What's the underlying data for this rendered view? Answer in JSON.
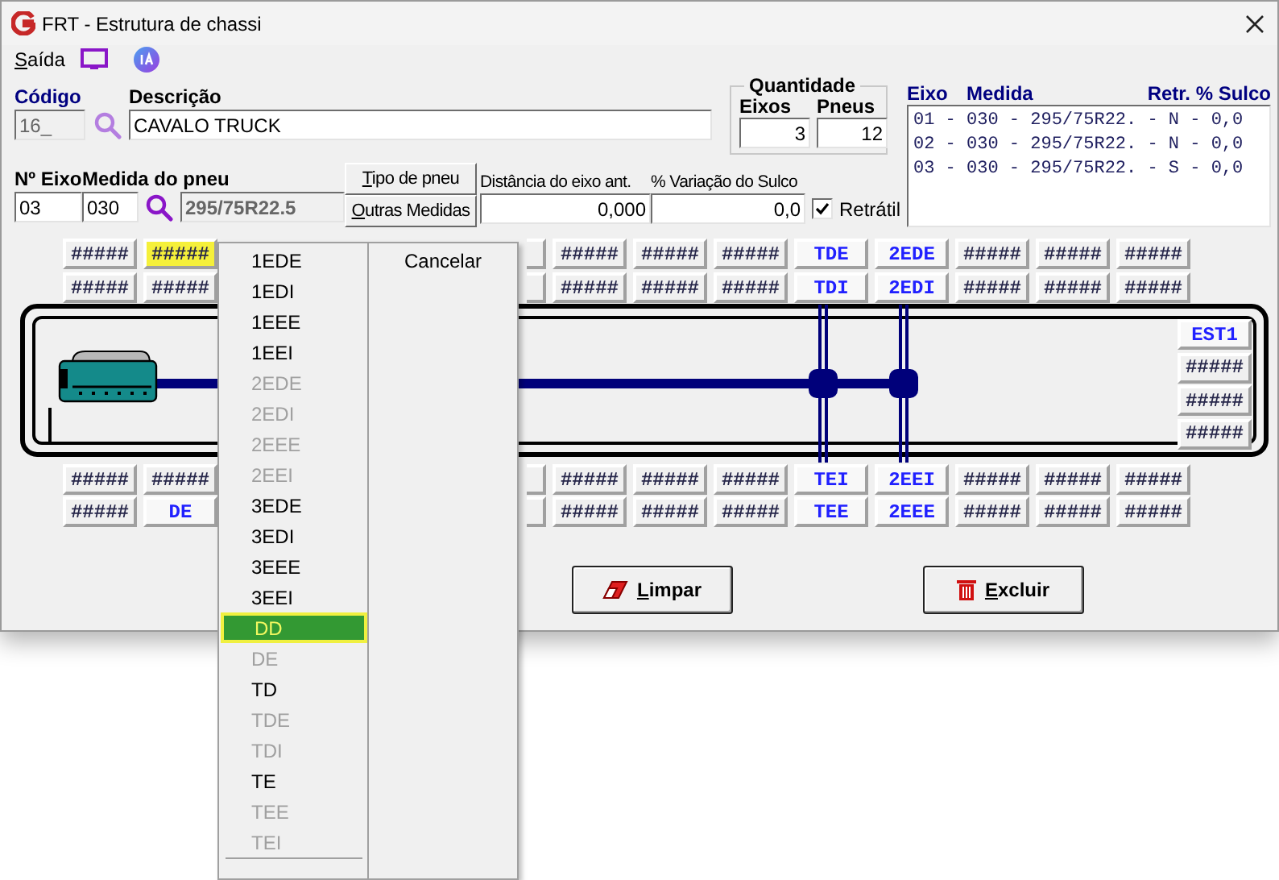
{
  "window": {
    "title": "FRT - Estrutura de chassi"
  },
  "menu_bar": [
    {
      "label": "Saída"
    }
  ],
  "form": {
    "codigo": {
      "label": "Código",
      "value": "16_"
    },
    "descricao": {
      "label": "Descrição",
      "value": "CAVALO TRUCK"
    },
    "quantidade": {
      "title": "Quantidade",
      "eixos": {
        "label": "Eixos",
        "value": "3"
      },
      "pneus": {
        "label": "Pneus",
        "value": "12"
      }
    },
    "axle_list": {
      "columns": [
        "Eixo",
        "Medida",
        "Retr.",
        "% Sulco"
      ],
      "rows": [
        "01 - 030 - 295/75R22. - N - 0,0",
        "02 - 030 - 295/75R22. - N - 0,0",
        "03 - 030 - 295/75R22. - S - 0,0"
      ]
    },
    "n_eixo": {
      "label": "Nº Eixo",
      "value": "03"
    },
    "medida": {
      "label": "Medida do pneu",
      "value": "030",
      "description": "295/75R22.5"
    },
    "buttons": [
      "Tipo de pneu",
      "Outras Medidas"
    ],
    "distancia": {
      "label": "Distância do eixo ant.",
      "value": "0,000"
    },
    "variacao": {
      "label": "% Variação do Sulco",
      "value": "0,0"
    },
    "retratil": {
      "label": "Retrátil",
      "checked": true
    }
  },
  "tire_grid": {
    "rows": [
      {
        "left": [
          {
            "label": "#####",
            "kind": "empty",
            "highlighted": false
          },
          {
            "label": "#####",
            "kind": "empty",
            "highlighted": true
          }
        ],
        "right": [
          {
            "label": "#####",
            "kind": "empty",
            "highlighted": false
          },
          {
            "label": "#####",
            "kind": "empty",
            "highlighted": false
          },
          {
            "label": "#####",
            "kind": "empty",
            "highlighted": false
          },
          {
            "label": "TDE",
            "kind": "assigned",
            "highlighted": false
          },
          {
            "label": "2EDE",
            "kind": "assigned",
            "highlighted": false
          },
          {
            "label": "#####",
            "kind": "empty",
            "highlighted": false
          },
          {
            "label": "#####",
            "kind": "empty",
            "highlighted": false
          },
          {
            "label": "#####",
            "kind": "empty",
            "highlighted": false
          }
        ]
      },
      {
        "left": [
          {
            "label": "#####",
            "kind": "empty",
            "highlighted": false
          },
          {
            "label": "#####",
            "kind": "empty",
            "highlighted": false
          }
        ],
        "right": [
          {
            "label": "#####",
            "kind": "empty",
            "highlighted": false
          },
          {
            "label": "#####",
            "kind": "empty",
            "highlighted": false
          },
          {
            "label": "#####",
            "kind": "empty",
            "highlighted": false
          },
          {
            "label": "TDI",
            "kind": "assigned",
            "highlighted": false
          },
          {
            "label": "2EDI",
            "kind": "assigned",
            "highlighted": false
          },
          {
            "label": "#####",
            "kind": "empty",
            "highlighted": false
          },
          {
            "label": "#####",
            "kind": "empty",
            "highlighted": false
          },
          {
            "label": "#####",
            "kind": "empty",
            "highlighted": false
          }
        ]
      },
      {
        "left": [
          {
            "label": "#####",
            "kind": "empty",
            "highlighted": false
          },
          {
            "label": "#####",
            "kind": "empty",
            "highlighted": false
          }
        ],
        "right": [
          {
            "label": "#####",
            "kind": "empty",
            "highlighted": false
          },
          {
            "label": "#####",
            "kind": "empty",
            "highlighted": false
          },
          {
            "label": "#####",
            "kind": "empty",
            "highlighted": false
          },
          {
            "label": "TEI",
            "kind": "assigned",
            "highlighted": false
          },
          {
            "label": "2EEI",
            "kind": "assigned",
            "highlighted": false
          },
          {
            "label": "#####",
            "kind": "empty",
            "highlighted": false
          },
          {
            "label": "#####",
            "kind": "empty",
            "highlighted": false
          },
          {
            "label": "#####",
            "kind": "empty",
            "highlighted": false
          }
        ]
      },
      {
        "left": [
          {
            "label": "#####",
            "kind": "empty",
            "highlighted": false
          },
          {
            "label": "DE",
            "kind": "assigned",
            "highlighted": false
          }
        ],
        "right": [
          {
            "label": "#####",
            "kind": "empty",
            "highlighted": false
          },
          {
            "label": "#####",
            "kind": "empty",
            "highlighted": false
          },
          {
            "label": "#####",
            "kind": "empty",
            "highlighted": false
          },
          {
            "label": "TEE",
            "kind": "assigned",
            "highlighted": false
          },
          {
            "label": "2EEE",
            "kind": "assigned",
            "highlighted": false
          },
          {
            "label": "#####",
            "kind": "empty",
            "highlighted": false
          },
          {
            "label": "#####",
            "kind": "empty",
            "highlighted": false
          },
          {
            "label": "#####",
            "kind": "empty",
            "highlighted": false
          }
        ]
      }
    ],
    "spare": [
      {
        "label": "EST1",
        "kind": "assigned",
        "highlighted": false
      },
      {
        "label": "#####",
        "kind": "empty",
        "highlighted": false
      },
      {
        "label": "#####",
        "kind": "empty",
        "highlighted": false
      },
      {
        "label": "#####",
        "kind": "empty",
        "highlighted": false
      }
    ]
  },
  "actions": [
    {
      "label": "Limpar",
      "kind": "clear"
    },
    {
      "label": "Excluir",
      "kind": "delete"
    }
  ],
  "context_menu": {
    "items": [
      {
        "label": "1EDE",
        "disabled": false,
        "selected": false
      },
      {
        "label": "1EDI",
        "disabled": false,
        "selected": false
      },
      {
        "label": "1EEE",
        "disabled": false,
        "selected": false
      },
      {
        "label": "1EEI",
        "disabled": false,
        "selected": false
      },
      {
        "label": "2EDE",
        "disabled": true,
        "selected": false
      },
      {
        "label": "2EDI",
        "disabled": true,
        "selected": false
      },
      {
        "label": "2EEE",
        "disabled": true,
        "selected": false
      },
      {
        "label": "2EEI",
        "disabled": true,
        "selected": false
      },
      {
        "label": "3EDE",
        "disabled": false,
        "selected": false
      },
      {
        "label": "3EDI",
        "disabled": false,
        "selected": false
      },
      {
        "label": "3EEE",
        "disabled": false,
        "selected": false
      },
      {
        "label": "3EEI",
        "disabled": false,
        "selected": false
      },
      {
        "label": "DD",
        "disabled": false,
        "selected": true
      },
      {
        "label": "DE",
        "disabled": true,
        "selected": false
      },
      {
        "label": "TD",
        "disabled": false,
        "selected": false
      },
      {
        "label": "TDE",
        "disabled": true,
        "selected": false
      },
      {
        "label": "TDI",
        "disabled": true,
        "selected": false
      },
      {
        "label": "TE",
        "disabled": false,
        "selected": false
      },
      {
        "label": "TEE",
        "disabled": true,
        "selected": false
      },
      {
        "label": "TEI",
        "disabled": true,
        "selected": false
      }
    ],
    "cancel": "Cancelar"
  }
}
